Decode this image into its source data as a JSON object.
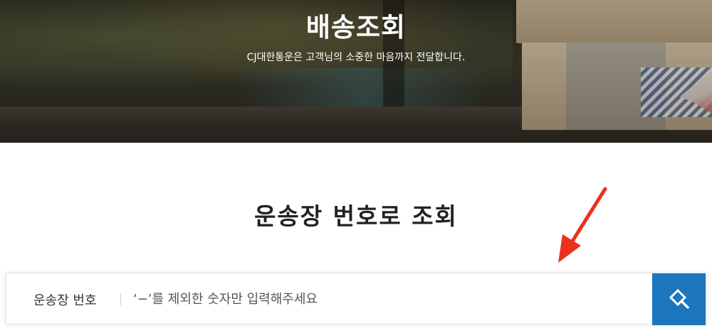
{
  "hero": {
    "title": "배송조회",
    "subtitle": "CJ대한통운은 고객님의 소중한 마음까지 전달합니다."
  },
  "tracking": {
    "section_title": "운송장 번호로 조회",
    "field_label": "운송장 번호",
    "input_placeholder": "‘−’를 제외한 숫자만 입력해주세요",
    "input_value": "",
    "search_icon": "search-icon"
  },
  "colors": {
    "accent": "#1d75bb",
    "annotation": "#e8321e",
    "title_text": "#222222"
  }
}
